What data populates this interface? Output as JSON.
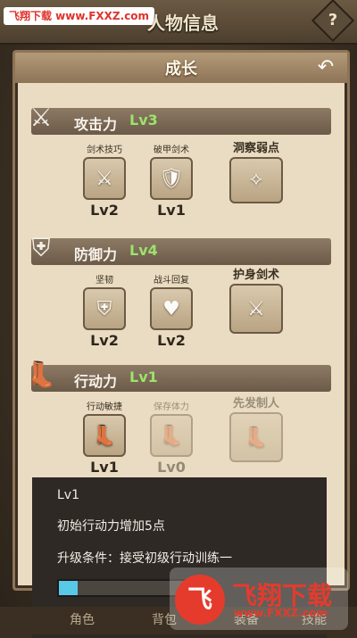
{
  "watermark_top": "飞翔下载 www.FXXZ.com",
  "header": {
    "title": "人物信息",
    "help_label": "?"
  },
  "panel": {
    "title": "成长",
    "back_label": "↶"
  },
  "sections": [
    {
      "label": "攻击力",
      "level": "Lv3",
      "icon": "sword-crest-icon",
      "skills": [
        {
          "name": "剑术技巧",
          "level": "Lv2",
          "icon": "sword-skill-icon",
          "enabled": true
        },
        {
          "name": "破甲剑术",
          "level": "Lv1",
          "icon": "armor-break-icon",
          "enabled": true
        },
        {
          "name": "洞察弱点",
          "level": "",
          "icon": "insight-icon",
          "enabled": true
        }
      ]
    },
    {
      "label": "防御力",
      "level": "Lv4",
      "icon": "shield-icon",
      "skills": [
        {
          "name": "坚韧",
          "level": "Lv2",
          "icon": "armor-icon",
          "enabled": true
        },
        {
          "name": "战斗回复",
          "level": "Lv2",
          "icon": "heart-icon",
          "enabled": true
        },
        {
          "name": "护身剑术",
          "level": "",
          "icon": "guard-icon",
          "enabled": true
        }
      ]
    },
    {
      "label": "行动力",
      "level": "Lv1",
      "icon": "boot-icon",
      "skills": [
        {
          "name": "行动敏捷",
          "level": "Lv1",
          "icon": "boot-skill-icon",
          "enabled": true
        },
        {
          "name": "保存体力",
          "level": "Lv0",
          "icon": "boot-rest-icon",
          "enabled": false
        },
        {
          "name": "先发制人",
          "level": "",
          "icon": "boot-first-icon",
          "enabled": false
        }
      ]
    }
  ],
  "info": {
    "level": "Lv1",
    "description": "初始行动力增加5点",
    "requirement": "升级条件：接受初级行动训练一",
    "progress": 0.15
  },
  "tabs": [
    "角色",
    "背包",
    "装备",
    "技能"
  ],
  "watermark": {
    "logo": "飞",
    "text": "飞翔下载",
    "url": "www.FXXZ.com"
  }
}
